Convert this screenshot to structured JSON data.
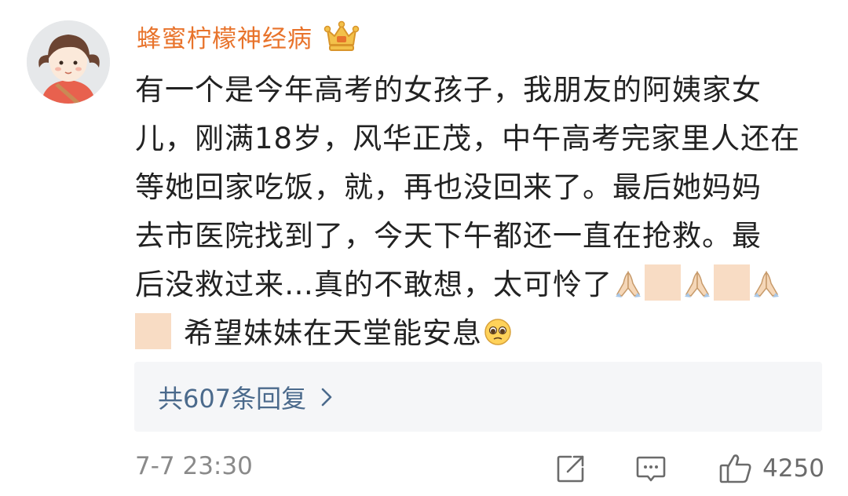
{
  "comment": {
    "username": "蜂蜜柠檬神经病",
    "badge_icon": "crown-icon",
    "username_color": "#e8732b",
    "lines": [
      "有一个是今年高考的女孩子，我朋友的阿姨家女",
      "儿，刚满18岁，风华正茂，中午高考完家里人还在",
      "等她回家吃饭，就，再也没回来了。最后她妈妈",
      "去市医院找到了，今天下午都还一直在抢救。最",
      "后没救过来…真的不敢想，太可怜了",
      "希望妹妹在天堂能安息"
    ],
    "emoji_icons": [
      "pray-hands-icon",
      "skin-tone-box",
      "pleading-face-icon"
    ]
  },
  "replies": {
    "label": "共607条回复",
    "link_color": "#4b6a8c"
  },
  "footer": {
    "timestamp": "7-7 23:30",
    "like_count": "4250"
  }
}
